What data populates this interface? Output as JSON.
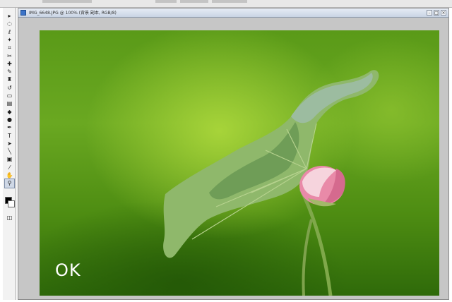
{
  "document": {
    "title": "IMG_6648.JPG @ 100% (背景 副本, RGB/8)",
    "minimize_glyph": "–",
    "maximize_glyph": "□",
    "close_glyph": "×"
  },
  "canvas": {
    "overlay_text": "OK",
    "subject": "lotus-bud-and-leaf-photo"
  },
  "toolbox": {
    "tools": [
      {
        "name": "move-tool-icon",
        "glyph": "▸"
      },
      {
        "name": "marquee-tool-icon",
        "glyph": "◌"
      },
      {
        "name": "lasso-tool-icon",
        "glyph": "ℓ"
      },
      {
        "name": "magic-wand-tool-icon",
        "glyph": "✦"
      },
      {
        "name": "crop-tool-icon",
        "glyph": "⌗"
      },
      {
        "name": "slice-tool-icon",
        "glyph": "✂"
      },
      {
        "name": "healing-brush-tool-icon",
        "glyph": "✚"
      },
      {
        "name": "brush-tool-icon",
        "glyph": "✎"
      },
      {
        "name": "clone-stamp-tool-icon",
        "glyph": "♜"
      },
      {
        "name": "history-brush-tool-icon",
        "glyph": "↺"
      },
      {
        "name": "eraser-tool-icon",
        "glyph": "▭"
      },
      {
        "name": "gradient-tool-icon",
        "glyph": "▤"
      },
      {
        "name": "blur-tool-icon",
        "glyph": "◆"
      },
      {
        "name": "dodge-tool-icon",
        "glyph": "●"
      },
      {
        "name": "pen-tool-icon",
        "glyph": "✒"
      },
      {
        "name": "type-tool-icon",
        "glyph": "T"
      },
      {
        "name": "path-selection-tool-icon",
        "glyph": "➤"
      },
      {
        "name": "line-tool-icon",
        "glyph": "╲"
      },
      {
        "name": "notes-tool-icon",
        "glyph": "▣"
      },
      {
        "name": "eyedropper-tool-icon",
        "glyph": "⁄"
      },
      {
        "name": "hand-tool-icon",
        "glyph": "✋"
      },
      {
        "name": "zoom-tool-icon",
        "glyph": "⚲"
      }
    ],
    "foreground_color": "#000000",
    "background_color": "#ffffff"
  },
  "colors": {
    "photo_green": "#4f8d15",
    "leaf": "#8db56a",
    "bud_pink": "#e98aa8"
  }
}
